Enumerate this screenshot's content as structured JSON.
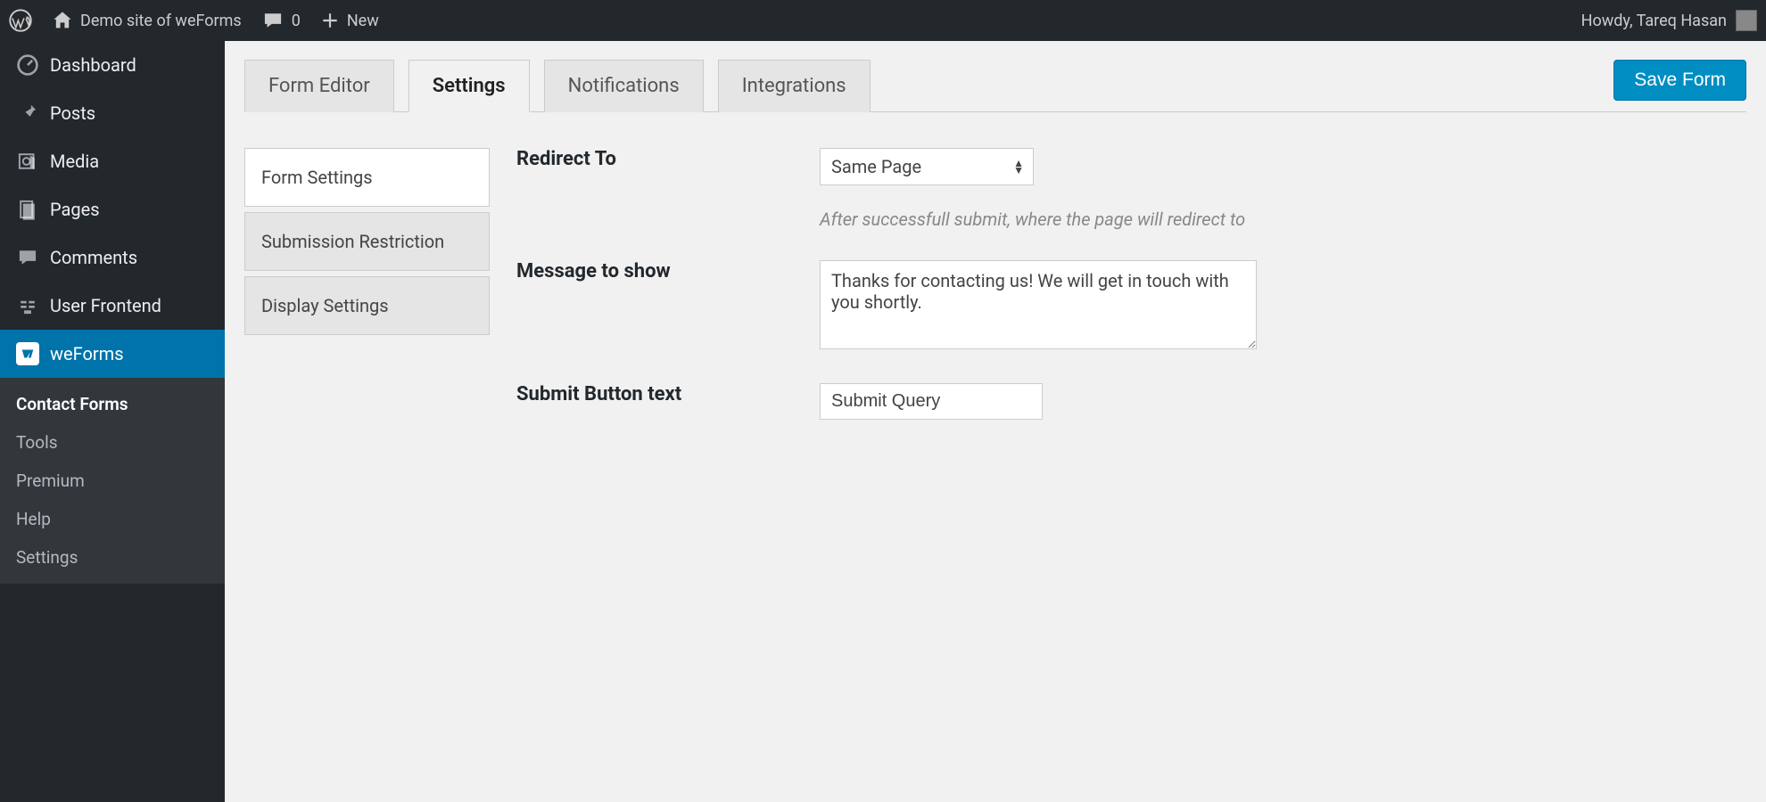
{
  "admin_bar": {
    "site_name": "Demo site of weForms",
    "comments_count": "0",
    "new_label": "New",
    "greeting": "Howdy, Tareq Hasan"
  },
  "sidebar": {
    "items": [
      {
        "label": "Dashboard"
      },
      {
        "label": "Posts"
      },
      {
        "label": "Media"
      },
      {
        "label": "Pages"
      },
      {
        "label": "Comments"
      },
      {
        "label": "User Frontend"
      },
      {
        "label": "weForms"
      }
    ],
    "submenu": [
      {
        "label": "Contact Forms"
      },
      {
        "label": "Tools"
      },
      {
        "label": "Premium"
      },
      {
        "label": "Help"
      },
      {
        "label": "Settings"
      }
    ]
  },
  "tabs": {
    "items": [
      {
        "label": "Form Editor"
      },
      {
        "label": "Settings"
      },
      {
        "label": "Notifications"
      },
      {
        "label": "Integrations"
      }
    ],
    "save_label": "Save Form"
  },
  "vtabs": [
    {
      "label": "Form Settings"
    },
    {
      "label": "Submission Restriction"
    },
    {
      "label": "Display Settings"
    }
  ],
  "fields": {
    "redirect_label": "Redirect To",
    "redirect_value": "Same Page",
    "redirect_help": "After successfull submit, where the page will redirect to",
    "message_label": "Message to show",
    "message_value": "Thanks for contacting us! We will get in touch with you shortly.",
    "submit_label": "Submit Button text",
    "submit_value": "Submit Query"
  }
}
